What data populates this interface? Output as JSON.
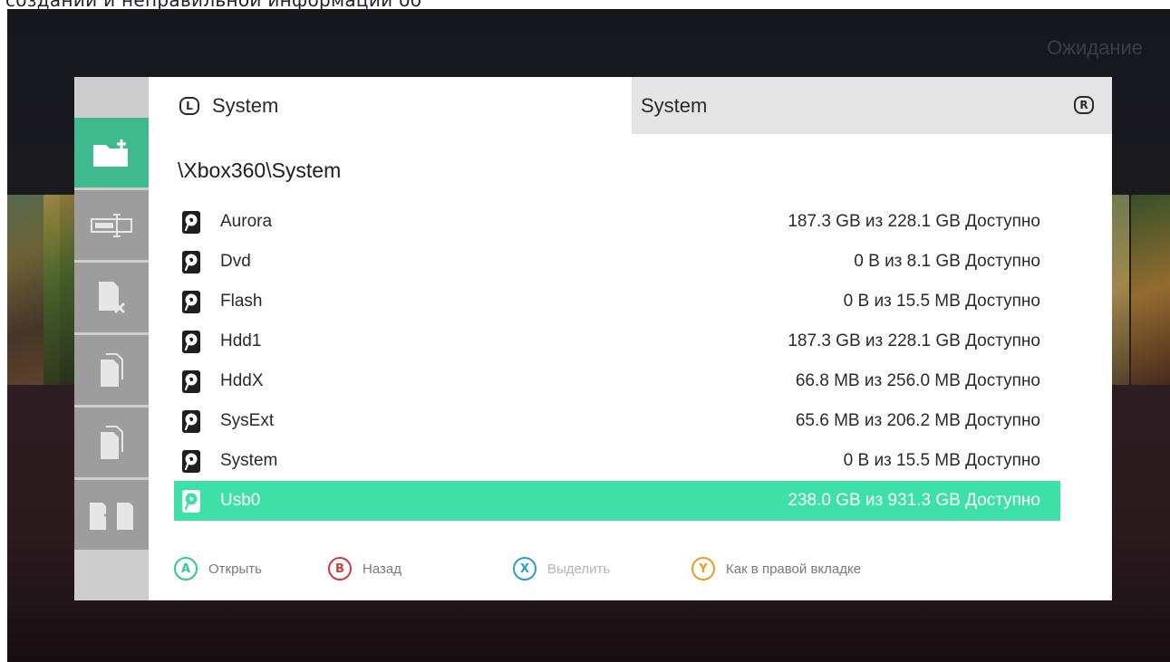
{
  "top_caption": "создании и неправильной информации об",
  "status": "Ожидание",
  "dialog": {
    "sidebar": {
      "buttons": [
        {
          "icon": "new-folder-icon",
          "active": true
        },
        {
          "icon": "rename-icon",
          "active": false
        },
        {
          "icon": "delete-file-icon",
          "active": false
        },
        {
          "icon": "copy-icon",
          "active": false
        },
        {
          "icon": "paste-icon",
          "active": false
        },
        {
          "icon": "move-icon",
          "active": false
        }
      ]
    },
    "tabs": {
      "left": {
        "shoulder": "L",
        "label": "System"
      },
      "right": {
        "shoulder": "R",
        "label": "System"
      }
    },
    "path": "\\Xbox360\\System",
    "drives": [
      {
        "name": "Aurora",
        "space": "187.3 GB из 228.1 GB Доступно",
        "selected": false
      },
      {
        "name": "Dvd",
        "space": "0 B из 8.1 GB Доступно",
        "selected": false
      },
      {
        "name": "Flash",
        "space": "0 B из 15.5 MB Доступно",
        "selected": false
      },
      {
        "name": "Hdd1",
        "space": "187.3 GB из 228.1 GB Доступно",
        "selected": false
      },
      {
        "name": "HddX",
        "space": "66.8 MB из 256.0 MB Доступно",
        "selected": false
      },
      {
        "name": "SysExt",
        "space": "65.6 MB из 206.2 MB Доступно",
        "selected": false
      },
      {
        "name": "System",
        "space": "0 B из 15.5 MB Доступно",
        "selected": false
      },
      {
        "name": "Usb0",
        "space": "238.0 GB из 931.3 GB Доступно",
        "selected": true
      }
    ],
    "hints": [
      {
        "button": "A",
        "label": "Открыть",
        "color": "#2ecc8e",
        "text_color": "#7a7a7a"
      },
      {
        "button": "B",
        "label": "Назад",
        "color": "#d03a3a",
        "text_color": "#7a7a7a"
      },
      {
        "button": "X",
        "label": "Выделить",
        "color": "#2a9ad8",
        "text_color": "#b4b4b4"
      },
      {
        "button": "Y",
        "label": "Как в правой вкладке",
        "color": "#e0a020",
        "text_color": "#7a7a7a"
      }
    ]
  },
  "colors": {
    "accent": "#3de0a6",
    "sidebar_active": "#3fba8e",
    "sidebar_button": "#9d9d9d"
  }
}
